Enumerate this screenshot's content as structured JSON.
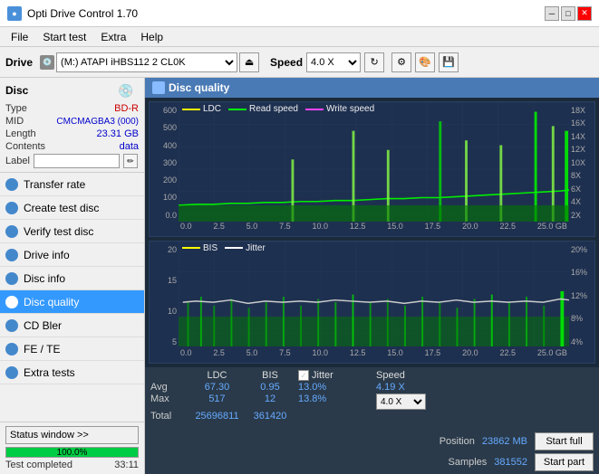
{
  "app": {
    "title": "Opti Drive Control 1.70",
    "icon": "disc-icon"
  },
  "title_controls": {
    "minimize": "─",
    "maximize": "□",
    "close": "✕"
  },
  "menu": {
    "items": [
      "File",
      "Start test",
      "Extra",
      "Help"
    ]
  },
  "toolbar": {
    "drive_label": "Drive",
    "drive_value": "(M:) ATAPI iHBS112  2 CL0K",
    "speed_label": "Speed",
    "speed_value": "4.0 X"
  },
  "disc": {
    "title": "Disc",
    "type_label": "Type",
    "type_value": "BD-R",
    "mid_label": "MID",
    "mid_value": "CMCMAGBA3 (000)",
    "length_label": "Length",
    "length_value": "23.31 GB",
    "contents_label": "Contents",
    "contents_value": "data",
    "label_label": "Label",
    "label_placeholder": ""
  },
  "nav": {
    "items": [
      {
        "id": "transfer-rate",
        "label": "Transfer rate"
      },
      {
        "id": "create-test-disc",
        "label": "Create test disc"
      },
      {
        "id": "verify-test-disc",
        "label": "Verify test disc"
      },
      {
        "id": "drive-info",
        "label": "Drive info"
      },
      {
        "id": "disc-info",
        "label": "Disc info"
      },
      {
        "id": "disc-quality",
        "label": "Disc quality",
        "active": true
      },
      {
        "id": "cd-bler",
        "label": "CD Bler"
      },
      {
        "id": "fe-te",
        "label": "FE / TE"
      },
      {
        "id": "extra-tests",
        "label": "Extra tests"
      }
    ]
  },
  "status": {
    "window_btn": "Status window >>",
    "progress": 100.0,
    "progress_text": "100.0%",
    "status_text": "Test completed",
    "time": "33:11"
  },
  "chart": {
    "title": "Disc quality",
    "top_legend": [
      {
        "label": "LDC",
        "color": "#ffff00"
      },
      {
        "label": "Read speed",
        "color": "#00ff00"
      },
      {
        "label": "Write speed",
        "color": "#ff44ff"
      }
    ],
    "top_y_left": [
      "600",
      "500",
      "400",
      "300",
      "200",
      "100",
      "0.0"
    ],
    "top_y_right": [
      "18X",
      "16X",
      "14X",
      "12X",
      "10X",
      "8X",
      "6X",
      "4X",
      "2X"
    ],
    "top_x": [
      "0.0",
      "2.5",
      "5.0",
      "7.5",
      "10.0",
      "12.5",
      "15.0",
      "17.5",
      "20.0",
      "22.5",
      "25.0 GB"
    ],
    "bottom_legend": [
      {
        "label": "BIS",
        "color": "#ffff00"
      },
      {
        "label": "Jitter",
        "color": "#ffffff"
      }
    ],
    "bottom_y_left": [
      "20",
      "15",
      "10",
      "5"
    ],
    "bottom_y_right": [
      "20%",
      "16%",
      "12%",
      "8%",
      "4%"
    ],
    "bottom_x": [
      "0.0",
      "2.5",
      "5.0",
      "7.5",
      "10.0",
      "12.5",
      "15.0",
      "17.5",
      "20.0",
      "22.5",
      "25.0 GB"
    ]
  },
  "stats": {
    "ldc_label": "LDC",
    "bis_label": "BIS",
    "jitter_label": "Jitter",
    "speed_label": "Speed",
    "position_label": "Position",
    "samples_label": "Samples",
    "avg_label": "Avg",
    "max_label": "Max",
    "total_label": "Total",
    "ldc_avg": "67.30",
    "ldc_max": "517",
    "ldc_total": "25696811",
    "bis_avg": "0.95",
    "bis_max": "12",
    "bis_total": "361420",
    "jitter_avg": "13.0%",
    "jitter_max": "13.8%",
    "speed_val": "4.19 X",
    "speed_select": "4.0 X",
    "position_val": "23862 MB",
    "samples_val": "381552",
    "start_full_btn": "Start full",
    "start_part_btn": "Start part"
  }
}
